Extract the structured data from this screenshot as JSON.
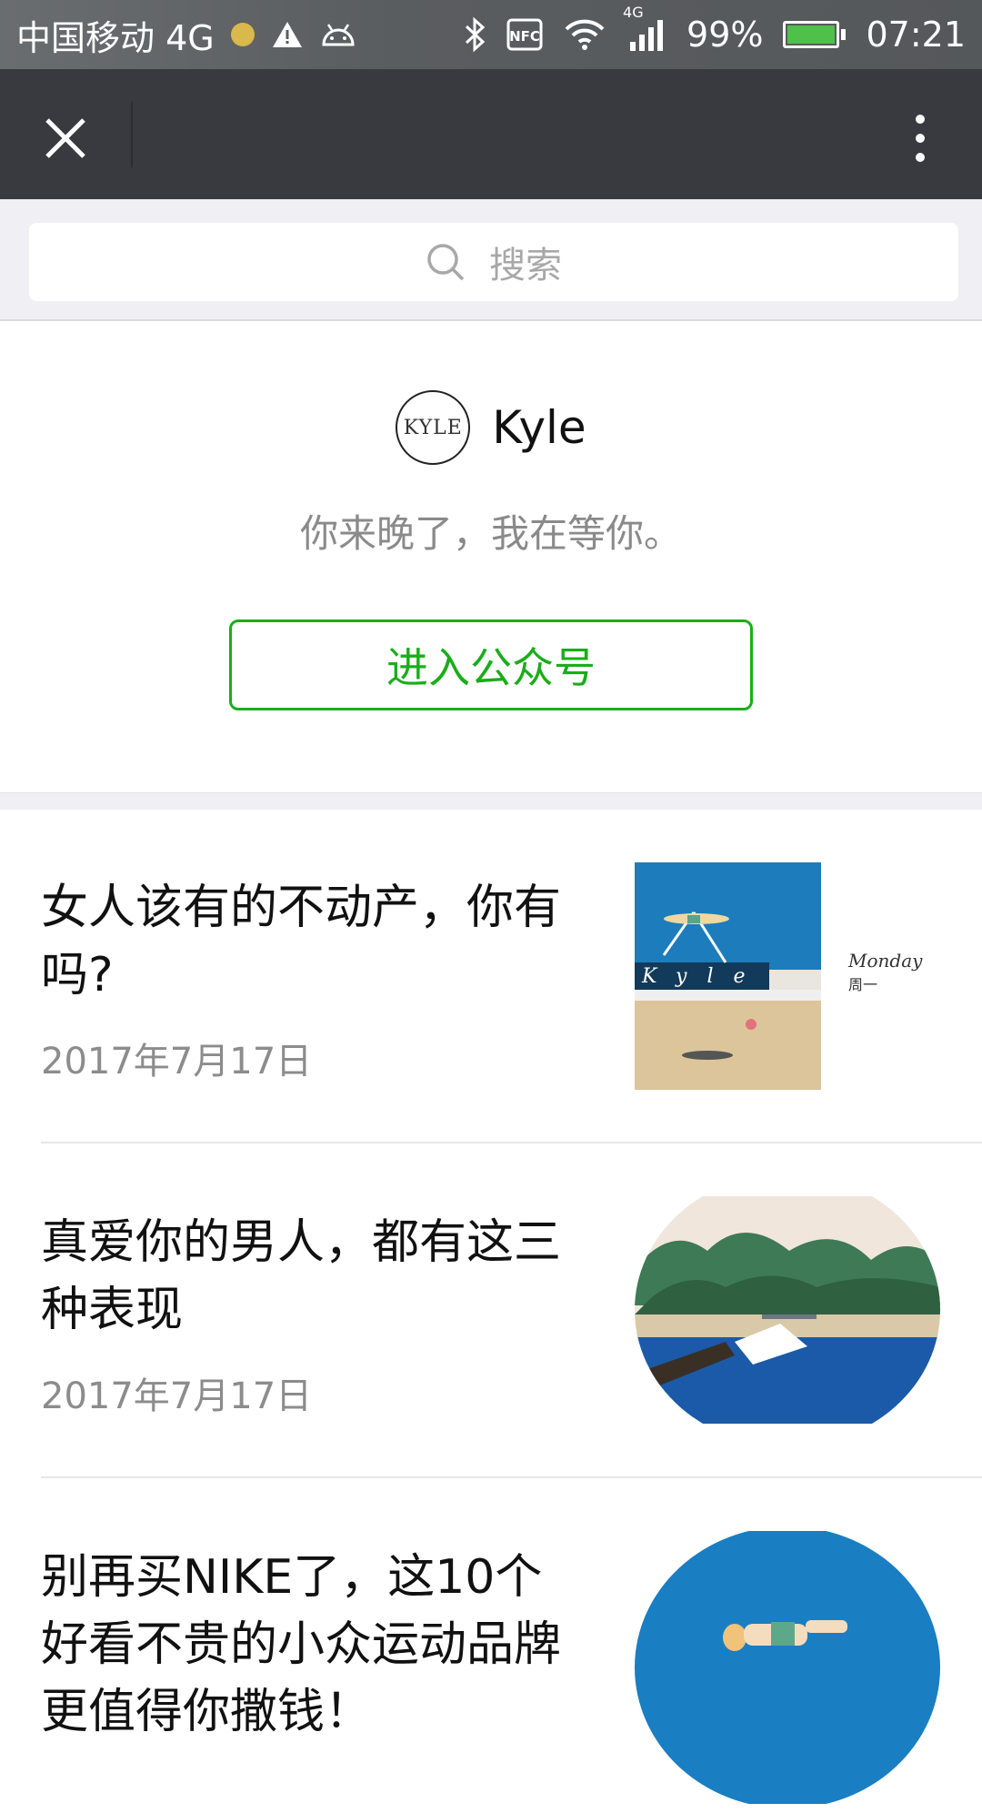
{
  "status_bar": {
    "carrier": "中国移动 4G",
    "network_badge": "4G",
    "battery": "99%",
    "time": "07:21",
    "icons": [
      "notification-dot",
      "warning-icon",
      "android-icon",
      "bluetooth-icon",
      "nfc-icon",
      "wifi-icon",
      "signal-icon",
      "battery-icon"
    ],
    "battery_level": 0.99
  },
  "nav": {
    "close_icon": "close-icon",
    "more_icon": "more-vertical-icon"
  },
  "search": {
    "placeholder": "搜索",
    "icon": "search-icon"
  },
  "profile": {
    "avatar_text": "KYLE",
    "name": "Kyle",
    "description": "你来晚了，我在等你。",
    "enter_button": "进入公众号",
    "accent_color": "#1aad19"
  },
  "articles": [
    {
      "title": "女人该有的不动产，你有吗?",
      "date": "2017年7月17日",
      "thumb_caption": "Kyle",
      "thumb_tag": "Monday",
      "thumb_tag_cn": "周一"
    },
    {
      "title": "真爱你的男人，都有这三种表现",
      "date": "2017年7月17日"
    },
    {
      "title": "别再买NIKE了，这10个好看不贵的小众运动品牌更值得你撒钱！"
    }
  ]
}
